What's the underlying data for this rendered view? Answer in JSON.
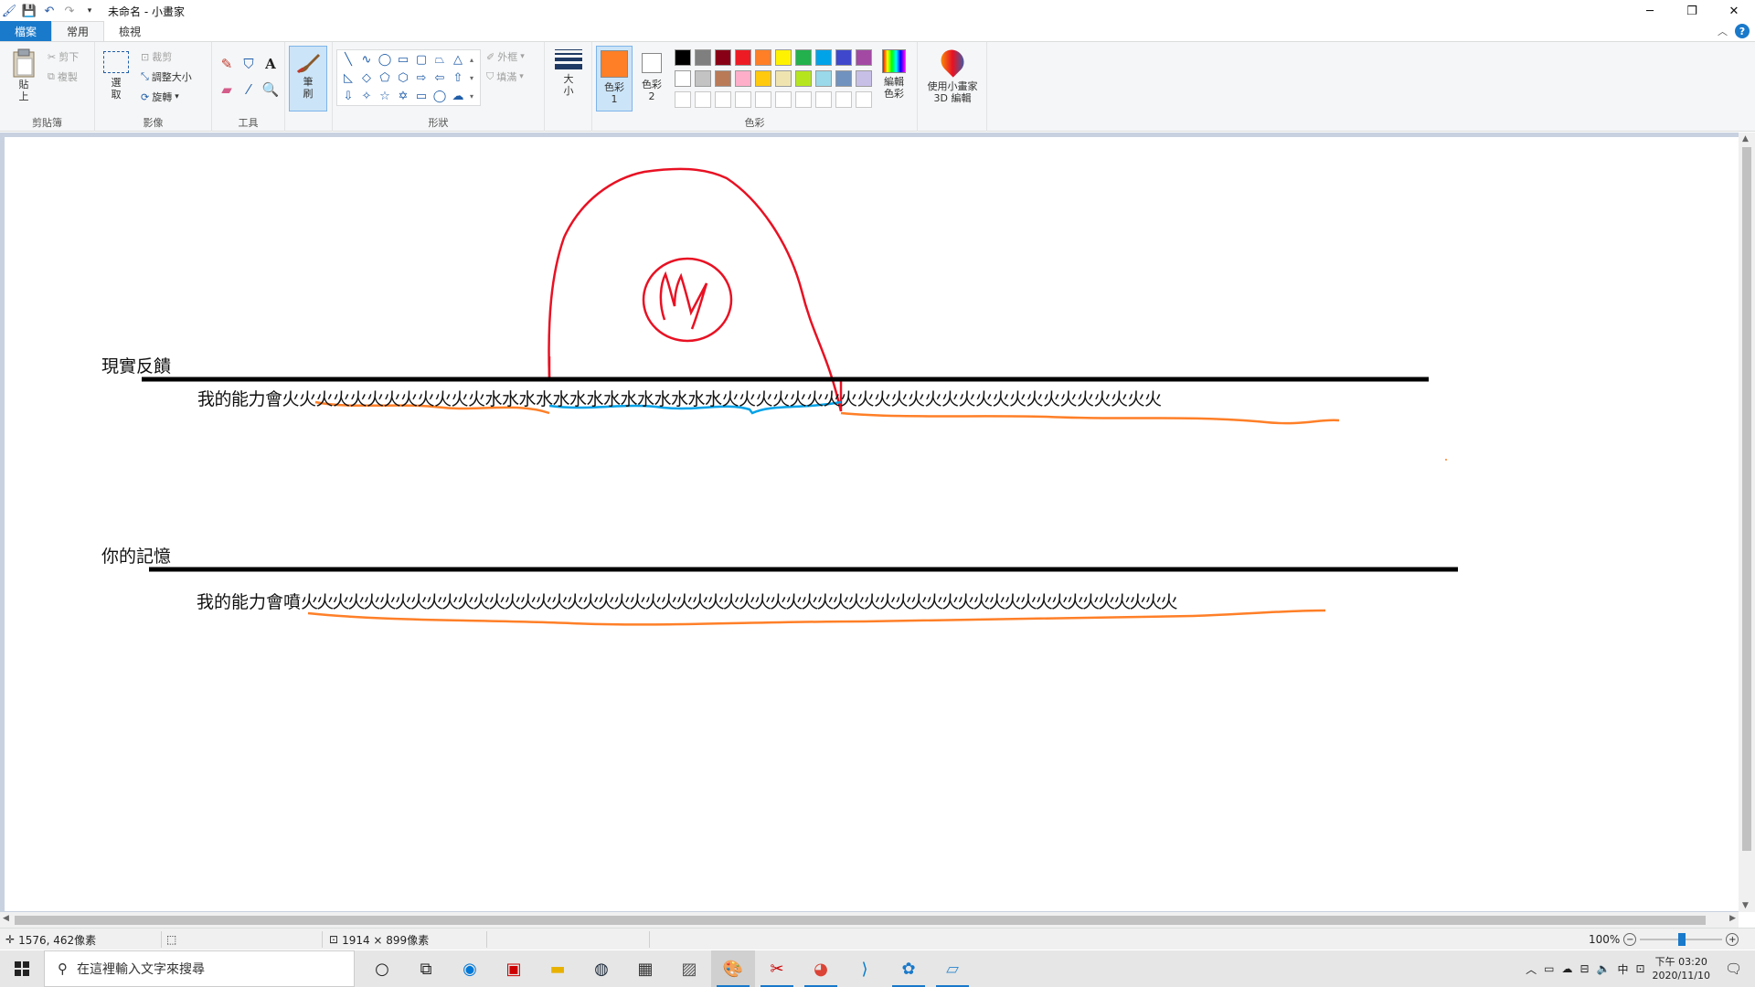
{
  "titlebar": {
    "title": "未命名 - 小畫家",
    "minimize_icon": "minimize-icon",
    "restore_icon": "restore-icon",
    "close_icon": "close-icon"
  },
  "tabs": [
    "檔案",
    "常用",
    "檢視"
  ],
  "ribbon": {
    "clipboard": {
      "label": "剪貼簿",
      "paste": "貼上",
      "cut": "剪下",
      "copy": "複製"
    },
    "image": {
      "label": "影像",
      "select": "選取",
      "crop": "裁剪",
      "resize": "調整大小",
      "rotate": "旋轉"
    },
    "tools": {
      "label": "工具"
    },
    "brushes": {
      "label": "筆刷"
    },
    "shapes": {
      "label": "形狀",
      "outline": "外框",
      "fill": "填滿"
    },
    "size": {
      "label": "大小"
    },
    "colors": {
      "label": "色彩",
      "color1": "色彩 1",
      "color2": "色彩 2",
      "edit": "編輯色彩",
      "color1_value": "#ff7f27",
      "color2_value": "#ffffff",
      "palette": [
        "#000000",
        "#7f7f7f",
        "#880015",
        "#ed1c24",
        "#ff7f27",
        "#fff200",
        "#22b14c",
        "#00a2e8",
        "#3f48cc",
        "#a349a4",
        "#ffffff",
        "#c3c3c3",
        "#b97a57",
        "#ffaec9",
        "#ffc90e",
        "#efe4b0",
        "#b5e61d",
        "#99d9ea",
        "#7092be",
        "#c8bfe7",
        "#ffffff",
        "#ffffff",
        "#ffffff",
        "#ffffff",
        "#ffffff",
        "#ffffff",
        "#ffffff",
        "#ffffff",
        "#ffffff",
        "#ffffff"
      ]
    },
    "paint3d": "使用小畫家 3D 編輯"
  },
  "canvas": {
    "label_top": "現實反饋",
    "label_bottom": "你的記憶",
    "line1_prefix": "我的能力會",
    "line1_fire_a": "火火火火火火火火火火火火",
    "line1_water": "水水水水水水水水水水水水水水",
    "line1_fire_b": "火火火火火火火火火火火火火火火火火火火火火火火火火火",
    "line2_prefix": "我的能力會噴",
    "line2_fire": "火火火火火火火火火火火火火火火火火火火火火火火火火火火火火火火火火火火火火火火火火火火火火火火火火火火火火火火火"
  },
  "status": {
    "cursor_pos": "1576, 462像素",
    "canvas_size": "1914 × 899像素",
    "zoom": "100%"
  },
  "taskbar": {
    "search_placeholder": "在這裡輸入文字來搜尋",
    "ime": "中",
    "time": "下午 03:20",
    "date": "2020/11/10"
  }
}
